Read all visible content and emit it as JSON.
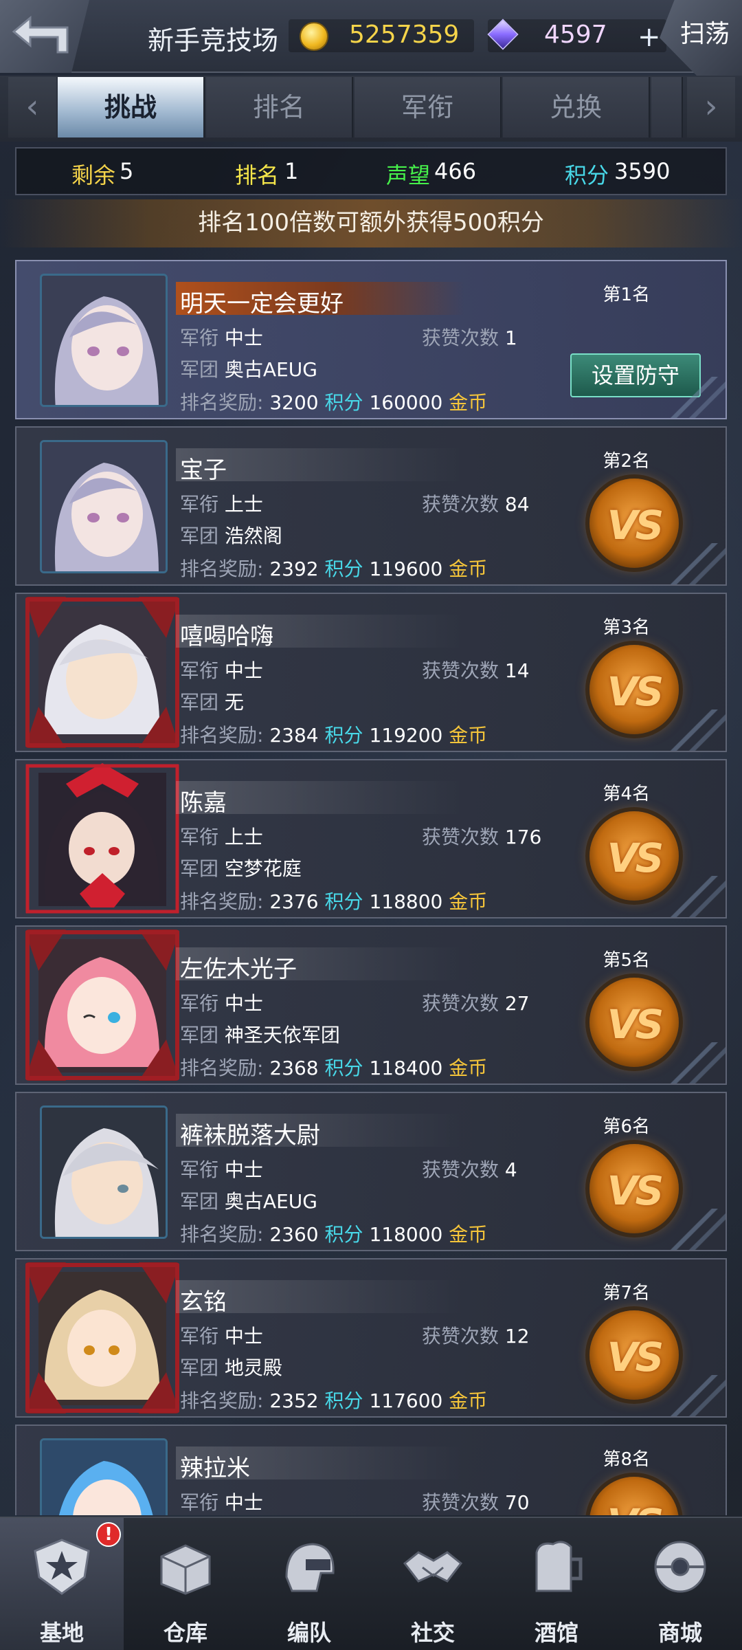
{
  "header": {
    "title": "新手竞技场",
    "gold": "5257359",
    "gems": "4597",
    "plus": "+",
    "sweep": "扫荡"
  },
  "tabs": [
    {
      "label": "挑战"
    },
    {
      "label": "排名"
    },
    {
      "label": "军衔"
    },
    {
      "label": "兑换"
    }
  ],
  "stats": {
    "remain_label": "剩余",
    "remain": "5",
    "rank_label": "排名",
    "rank": "1",
    "prestige_label": "声望",
    "prestige": "466",
    "score_label": "积分",
    "score": "3590"
  },
  "banner": "排名100倍数可额外获得500积分",
  "labels": {
    "rank_title": "军衔",
    "legion": "军团",
    "likes": "获赞次数",
    "reward": "排名奖励:",
    "points": "积分",
    "gold": "金币",
    "defend": "设置防守",
    "vs": "VS"
  },
  "players": [
    {
      "rank": "第1名",
      "name": "明天一定会更好",
      "title": "中士",
      "legion": "奥古AEUG",
      "likes": "1",
      "points": "3200",
      "gold": "160000"
    },
    {
      "rank": "第2名",
      "name": "宝子",
      "title": "上士",
      "legion": "浩然阁",
      "likes": "84",
      "points": "2392",
      "gold": "119600"
    },
    {
      "rank": "第3名",
      "name": "嘻喝哈嗨",
      "title": "中士",
      "legion": "无",
      "likes": "14",
      "points": "2384",
      "gold": "119200"
    },
    {
      "rank": "第4名",
      "name": "陈嘉",
      "title": "上士",
      "legion": "空梦花庭",
      "likes": "176",
      "points": "2376",
      "gold": "118800"
    },
    {
      "rank": "第5名",
      "name": "左佐木光子",
      "title": "中士",
      "legion": "神圣天依军团",
      "likes": "27",
      "points": "2368",
      "gold": "118400"
    },
    {
      "rank": "第6名",
      "name": "裤袜脱落大尉",
      "title": "中士",
      "legion": "奥古AEUG",
      "likes": "4",
      "points": "2360",
      "gold": "118000"
    },
    {
      "rank": "第7名",
      "name": "玄铭",
      "title": "中士",
      "legion": "地灵殿",
      "likes": "12",
      "points": "2352",
      "gold": "117600"
    },
    {
      "rank": "第8名",
      "name": "辣拉米",
      "title": "中士",
      "legion": "",
      "likes": "70",
      "points": "",
      "gold": ""
    }
  ],
  "nav": [
    {
      "label": "基地",
      "badge": "!"
    },
    {
      "label": "仓库"
    },
    {
      "label": "编队"
    },
    {
      "label": "社交"
    },
    {
      "label": "酒馆"
    },
    {
      "label": "商城"
    }
  ]
}
